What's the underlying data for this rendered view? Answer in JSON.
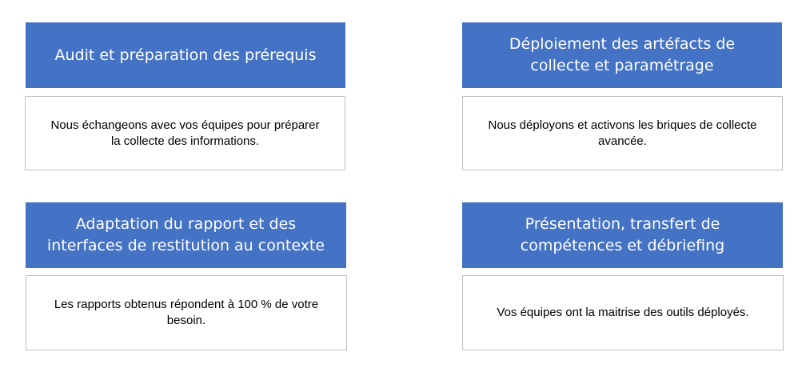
{
  "steps": [
    {
      "title_lines": [
        "Audit et préparation des prérequis"
      ],
      "description_lines": [
        "Nous échangeons avec vos équipes pour préparer",
        "la collecte des informations."
      ]
    },
    {
      "title_lines": [
        "Déploiement des artéfacts de",
        "collecte et paramétrage"
      ],
      "description_lines": [
        "Nous déployons et activons les briques de collecte",
        "avancée."
      ]
    },
    {
      "title_lines": [
        "Adaptation du rapport et des",
        "interfaces de restitution au contexte"
      ],
      "description_lines": [
        "Les rapports obtenus répondent à 100 % de votre",
        "besoin."
      ]
    },
    {
      "title_lines": [
        "Présentation, transfert de",
        "compétences et débriefing"
      ],
      "description_lines": [
        "Vos équipes ont la maitrise des outils déployés."
      ]
    }
  ],
  "colors": {
    "header_background": "#4472c4",
    "header_text": "#ffffff",
    "body_border": "#bfbfbf"
  }
}
